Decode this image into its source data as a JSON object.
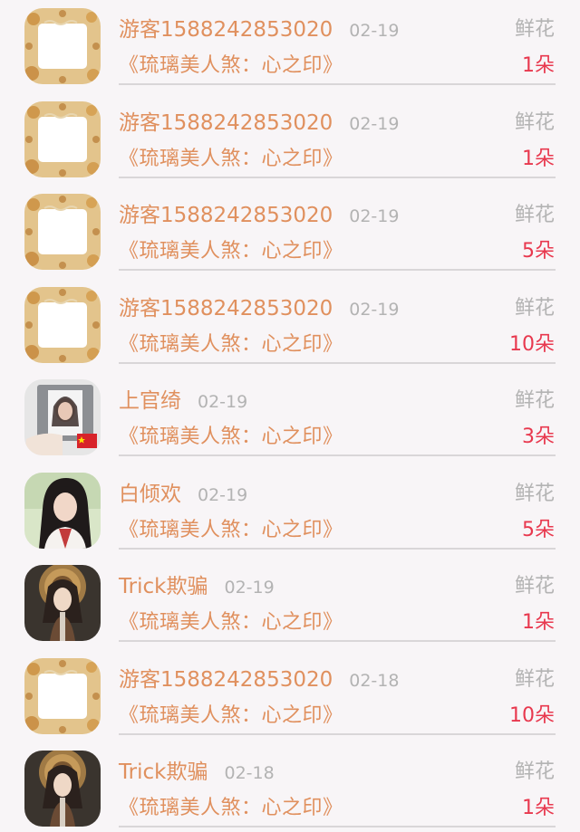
{
  "gift_records": [
    {
      "name": "游客1588242853020",
      "date": "02-19",
      "book": "《琉璃美人煞：心之印》",
      "gift": "鲜花",
      "count": "1朵",
      "avatar": "frame-avatar-icon"
    },
    {
      "name": "游客1588242853020",
      "date": "02-19",
      "book": "《琉璃美人煞：心之印》",
      "gift": "鲜花",
      "count": "1朵",
      "avatar": "frame-avatar-icon"
    },
    {
      "name": "游客1588242853020",
      "date": "02-19",
      "book": "《琉璃美人煞：心之印》",
      "gift": "鲜花",
      "count": "5朵",
      "avatar": "frame-avatar-icon"
    },
    {
      "name": "游客1588242853020",
      "date": "02-19",
      "book": "《琉璃美人煞：心之印》",
      "gift": "鲜花",
      "count": "10朵",
      "avatar": "frame-avatar-icon"
    },
    {
      "name": "上官绮",
      "date": "02-19",
      "book": "《琉璃美人煞：心之印》",
      "gift": "鲜花",
      "count": "3朵",
      "avatar": "photo-avatar-icon"
    },
    {
      "name": "白倾欢",
      "date": "02-19",
      "book": "《琉璃美人煞：心之印》",
      "gift": "鲜花",
      "count": "5朵",
      "avatar": "woman-avatar-icon"
    },
    {
      "name": "Trick欺骗",
      "date": "02-19",
      "book": "《琉璃美人煞：心之印》",
      "gift": "鲜花",
      "count": "1朵",
      "avatar": "dark-avatar-icon"
    },
    {
      "name": "游客1588242853020",
      "date": "02-18",
      "book": "《琉璃美人煞：心之印》",
      "gift": "鲜花",
      "count": "10朵",
      "avatar": "frame-avatar-icon"
    },
    {
      "name": "Trick欺骗",
      "date": "02-18",
      "book": "《琉璃美人煞：心之印》",
      "gift": "鲜花",
      "count": "1朵",
      "avatar": "dark-avatar-icon"
    }
  ],
  "colors": {
    "name": "#e0905e",
    "count": "#e8384e",
    "muted": "#b3b3b3",
    "background": "#f8f5f7"
  }
}
